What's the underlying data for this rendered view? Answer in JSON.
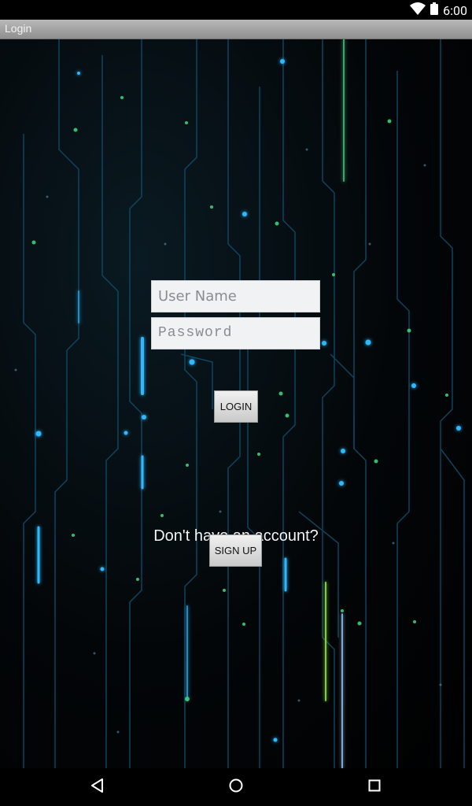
{
  "status_bar": {
    "time": "6:00"
  },
  "app": {
    "title": "Login"
  },
  "form": {
    "username_placeholder": "User Name",
    "password_placeholder": "Password",
    "login_label": "LOGIN"
  },
  "signup": {
    "prompt": "Don't have an account?",
    "button_label": "SIGN UP"
  },
  "nav": {
    "back_icon": "back-icon",
    "home_icon": "home-icon",
    "recents_icon": "recents-icon"
  },
  "colors": {
    "accent_cyan": "#2fb8ff",
    "accent_green": "#37d27a",
    "title_bar": "#a6a6a6"
  }
}
